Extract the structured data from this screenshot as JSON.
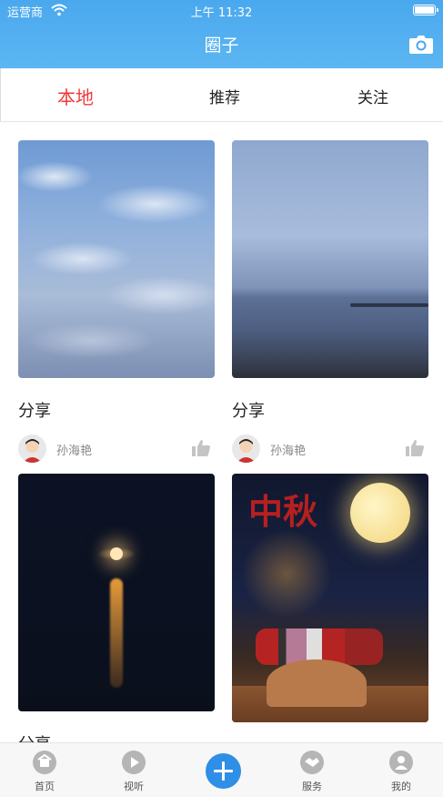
{
  "status_bar": {
    "carrier": "运营商",
    "time": "上午 11:32"
  },
  "header": {
    "title": "圈子"
  },
  "tabs": [
    {
      "label": "本地",
      "active": true
    },
    {
      "label": "推荐",
      "active": false
    },
    {
      "label": "关注",
      "active": false
    }
  ],
  "posts": [
    {
      "caption": "分享",
      "author": "孙海艳"
    },
    {
      "caption": "分享",
      "author": "孙海艳"
    },
    {
      "caption": "分享",
      "author": ""
    },
    {
      "caption": "",
      "author": ""
    }
  ],
  "festival_image_text": "中秋",
  "bottom_nav": [
    {
      "label": "首页",
      "icon": "home-icon"
    },
    {
      "label": "视听",
      "icon": "play-icon"
    },
    {
      "label": "服务",
      "icon": "handshake-icon"
    },
    {
      "label": "我的",
      "icon": "user-icon"
    }
  ],
  "colors": {
    "header": "#4aa8ee",
    "active_tab": "#f03a3a",
    "add_button": "#2f8ee6"
  }
}
